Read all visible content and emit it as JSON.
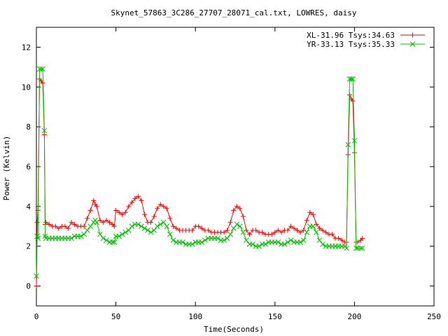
{
  "chart_data": {
    "type": "line",
    "title": "Skynet_57863_3C286_27707_28071_cal.txt, LOWRES, daisy",
    "xlabel": "Time(Seconds)",
    "ylabel": "Power (Kelvin)",
    "xlim": [
      0,
      250
    ],
    "ylim": [
      -1,
      13
    ],
    "xticks": [
      0,
      50,
      100,
      150,
      200,
      250
    ],
    "yticks": [
      0,
      2,
      4,
      6,
      8,
      10,
      12
    ],
    "grid": false,
    "legend_position": "top-right",
    "series": [
      {
        "name": "XL-31.96 Tsys:34.63",
        "color": "#ff0000",
        "marker": "plus",
        "x": [
          0,
          0.5,
          1,
          2,
          3,
          4,
          5,
          5.5,
          6,
          8,
          10,
          12,
          14,
          16,
          18,
          20,
          22,
          24,
          26,
          28,
          30,
          32,
          34,
          36,
          37,
          38,
          40,
          42,
          44,
          46,
          48,
          49,
          50,
          52,
          54,
          56,
          58,
          60,
          62,
          64,
          66,
          68,
          70,
          72,
          74,
          76,
          78,
          80,
          82,
          84,
          86,
          88,
          90,
          92,
          94,
          96,
          98,
          100,
          102,
          104,
          106,
          108,
          110,
          112,
          114,
          116,
          118,
          120,
          122,
          124,
          126,
          128,
          130,
          132,
          134,
          136,
          138,
          140,
          142,
          144,
          146,
          148,
          150,
          152,
          154,
          156,
          158,
          160,
          162,
          164,
          166,
          168,
          170,
          172,
          174,
          176,
          178,
          180,
          182,
          184,
          186,
          188,
          190,
          192,
          194,
          195,
          196,
          197,
          198,
          199,
          200,
          201,
          202,
          204,
          205
        ],
        "y": [
          0,
          3.2,
          3.8,
          10.4,
          10.3,
          10.2,
          7.6,
          3.1,
          3.2,
          3.1,
          3.0,
          3.0,
          2.9,
          3.0,
          3.0,
          2.9,
          3.2,
          3.1,
          3.0,
          3.0,
          3.0,
          3.4,
          3.8,
          4.3,
          4.1,
          4.0,
          3.3,
          3.2,
          3.3,
          3.2,
          3.1,
          3.0,
          3.8,
          3.7,
          3.6,
          3.7,
          4.0,
          4.2,
          4.4,
          4.5,
          4.3,
          3.6,
          3.2,
          3.2,
          3.5,
          3.9,
          4.1,
          4.0,
          3.9,
          3.4,
          3.0,
          2.9,
          2.8,
          2.8,
          2.8,
          2.8,
          2.8,
          3.0,
          3.0,
          2.9,
          2.8,
          2.8,
          2.7,
          2.7,
          2.7,
          2.7,
          2.7,
          2.8,
          3.2,
          3.8,
          4.0,
          3.9,
          3.5,
          2.8,
          2.6,
          2.8,
          2.8,
          2.7,
          2.7,
          2.6,
          2.6,
          2.6,
          2.7,
          2.8,
          2.7,
          2.8,
          2.8,
          3.0,
          2.9,
          2.8,
          2.7,
          2.8,
          3.3,
          3.7,
          3.6,
          3.1,
          2.9,
          2.8,
          2.7,
          2.6,
          2.6,
          2.4,
          2.4,
          2.3,
          2.2,
          2.2,
          6.6,
          9.6,
          9.4,
          9.3,
          6.7,
          2.2,
          2.2,
          2.3,
          2.4
        ]
      },
      {
        "name": "YR-33.13 Tsys:35.33",
        "color": "#00c000",
        "marker": "cross",
        "x": [
          0,
          0.5,
          1,
          2,
          3,
          4,
          5,
          5.5,
          6,
          8,
          10,
          12,
          14,
          16,
          18,
          20,
          22,
          24,
          26,
          28,
          30,
          32,
          34,
          36,
          37,
          38,
          40,
          42,
          44,
          46,
          48,
          49,
          50,
          52,
          54,
          56,
          58,
          60,
          62,
          64,
          66,
          68,
          70,
          72,
          74,
          76,
          78,
          80,
          82,
          84,
          86,
          88,
          90,
          92,
          94,
          96,
          98,
          100,
          102,
          104,
          106,
          108,
          110,
          112,
          114,
          116,
          118,
          120,
          122,
          124,
          126,
          128,
          130,
          132,
          134,
          136,
          138,
          140,
          142,
          144,
          146,
          148,
          150,
          152,
          154,
          156,
          158,
          160,
          162,
          164,
          166,
          168,
          170,
          172,
          174,
          176,
          178,
          180,
          182,
          184,
          186,
          188,
          190,
          192,
          194,
          195,
          196,
          197,
          198,
          199,
          200,
          201,
          202,
          204,
          205
        ],
        "y": [
          0.5,
          2.5,
          2.4,
          10.9,
          10.9,
          10.9,
          7.8,
          2.5,
          2.4,
          2.4,
          2.4,
          2.4,
          2.4,
          2.4,
          2.4,
          2.4,
          2.4,
          2.5,
          2.5,
          2.5,
          2.6,
          2.8,
          3.0,
          3.2,
          3.3,
          3.2,
          2.6,
          2.4,
          2.3,
          2.2,
          2.2,
          2.2,
          2.5,
          2.5,
          2.6,
          2.7,
          2.8,
          3.0,
          3.1,
          3.1,
          3.0,
          2.9,
          2.8,
          2.7,
          2.8,
          3.0,
          3.1,
          3.2,
          3.0,
          2.6,
          2.3,
          2.2,
          2.2,
          2.2,
          2.1,
          2.1,
          2.1,
          2.2,
          2.2,
          2.2,
          2.3,
          2.4,
          2.4,
          2.4,
          2.4,
          2.3,
          2.3,
          2.4,
          2.6,
          2.9,
          3.1,
          3.0,
          2.7,
          2.3,
          2.1,
          2.1,
          2.0,
          2.0,
          2.1,
          2.1,
          2.2,
          2.2,
          2.2,
          2.2,
          2.1,
          2.1,
          2.2,
          2.3,
          2.2,
          2.2,
          2.2,
          2.3,
          2.7,
          3.0,
          3.0,
          2.7,
          2.3,
          2.1,
          2.0,
          2.0,
          2.0,
          2.0,
          2.0,
          2.0,
          2.0,
          1.9,
          7.1,
          10.4,
          10.4,
          10.4,
          7.3,
          1.9,
          1.9,
          1.9,
          1.9
        ]
      }
    ]
  }
}
